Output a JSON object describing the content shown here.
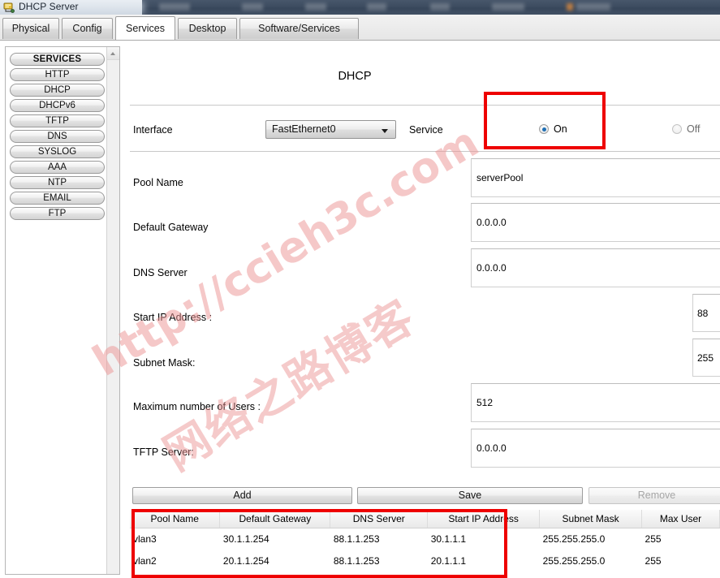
{
  "window": {
    "title": "DHCP Server",
    "icon": "server-icon"
  },
  "tabs": [
    {
      "label": "Physical",
      "active": false
    },
    {
      "label": "Config",
      "active": false
    },
    {
      "label": "Services",
      "active": true
    },
    {
      "label": "Desktop",
      "active": false
    },
    {
      "label": "Software/Services",
      "active": false
    }
  ],
  "sidebar": {
    "items": [
      {
        "label": "SERVICES",
        "header": true
      },
      {
        "label": "HTTP",
        "header": false
      },
      {
        "label": "DHCP",
        "header": false
      },
      {
        "label": "DHCPv6",
        "header": false
      },
      {
        "label": "TFTP",
        "header": false
      },
      {
        "label": "DNS",
        "header": false
      },
      {
        "label": "SYSLOG",
        "header": false
      },
      {
        "label": "AAA",
        "header": false
      },
      {
        "label": "NTP",
        "header": false
      },
      {
        "label": "EMAIL",
        "header": false
      },
      {
        "label": "FTP",
        "header": false
      }
    ]
  },
  "main": {
    "title": "DHCP",
    "interface_label": "Interface",
    "interface_value": "FastEthernet0",
    "service_label": "Service",
    "service_on_label": "On",
    "service_off_label": "Off",
    "service_state": "On",
    "fields": [
      {
        "label": "Pool Name",
        "value": "serverPool"
      },
      {
        "label": "Default Gateway",
        "value": "0.0.0.0"
      },
      {
        "label": "DNS Server",
        "value": "0.0.0.0"
      },
      {
        "label": "Start IP Address :",
        "value": "88"
      },
      {
        "label": "Subnet Mask:",
        "value": "255"
      },
      {
        "label": "Maximum number of Users :",
        "value": "512"
      },
      {
        "label": "TFTP Server:",
        "value": "0.0.0.0"
      }
    ],
    "buttons": {
      "add": "Add",
      "save": "Save",
      "remove": "Remove"
    }
  },
  "table": {
    "columns": [
      "Pool Name",
      "Default Gateway",
      "DNS Server",
      "Start IP Address",
      "Subnet Mask",
      "Max User"
    ],
    "rows": [
      [
        "vlan3",
        "30.1.1.254",
        "88.1.1.253",
        "30.1.1.1",
        "255.255.255.0",
        "255"
      ],
      [
        "vlan2",
        "20.1.1.254",
        "88.1.1.253",
        "20.1.1.1",
        "255.255.255.0",
        "255"
      ]
    ]
  },
  "watermark": {
    "url": "http://ccieh3c.com",
    "text_cn": "网络之路博客"
  },
  "annotations": {
    "accent_color": "#ee0000",
    "boxes": [
      {
        "name": "service-on-highlight"
      },
      {
        "name": "pool-table-highlight"
      }
    ]
  }
}
